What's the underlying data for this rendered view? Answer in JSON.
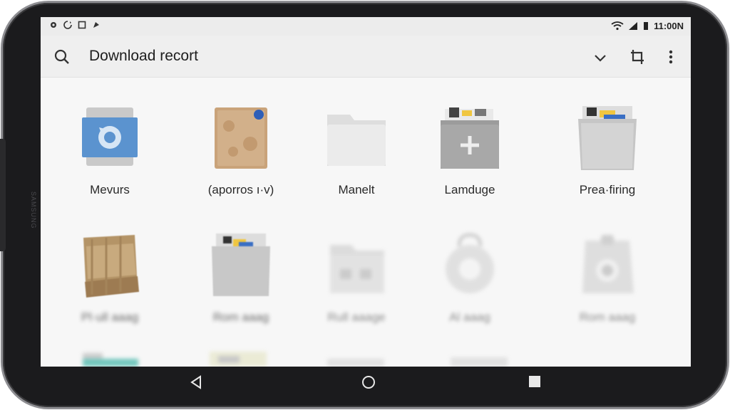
{
  "status_bar": {
    "time": "11:00N",
    "icons_left": [
      "notification-icon",
      "sync-icon",
      "gallery-icon",
      "app-icon"
    ],
    "icons_right": [
      "wifi-icon",
      "signal-icon",
      "battery-icon"
    ]
  },
  "app_bar": {
    "title": "Download recort",
    "actions": [
      "search-icon",
      "chevron-down-icon",
      "crop-icon",
      "more-vert-icon"
    ]
  },
  "folders_row1": [
    {
      "label": "Mevurs",
      "icon": "backup-folder-icon"
    },
    {
      "label": "(aporros  ı·v)",
      "icon": "cardboard-folder-icon"
    },
    {
      "label": "Manelt",
      "icon": "folder-icon"
    },
    {
      "label": "Lamduge",
      "icon": "add-folder-icon"
    },
    {
      "label": "Prea·firing",
      "icon": "documents-folder-icon"
    }
  ],
  "folders_row2": [
    {
      "label": "Pl·ull aaag",
      "icon": "fabric-folder-icon"
    },
    {
      "label": "Rom aaag",
      "icon": "documents-folder-icon"
    },
    {
      "label": "Rull aaage",
      "icon": "photo-folder-icon"
    },
    {
      "label": "Al aaag",
      "icon": "ring-icon"
    },
    {
      "label": "Rom aaag",
      "icon": "camera-folder-icon"
    }
  ],
  "nav": [
    "back-icon",
    "home-icon",
    "recents-icon"
  ],
  "brand": "SAMSUNG"
}
